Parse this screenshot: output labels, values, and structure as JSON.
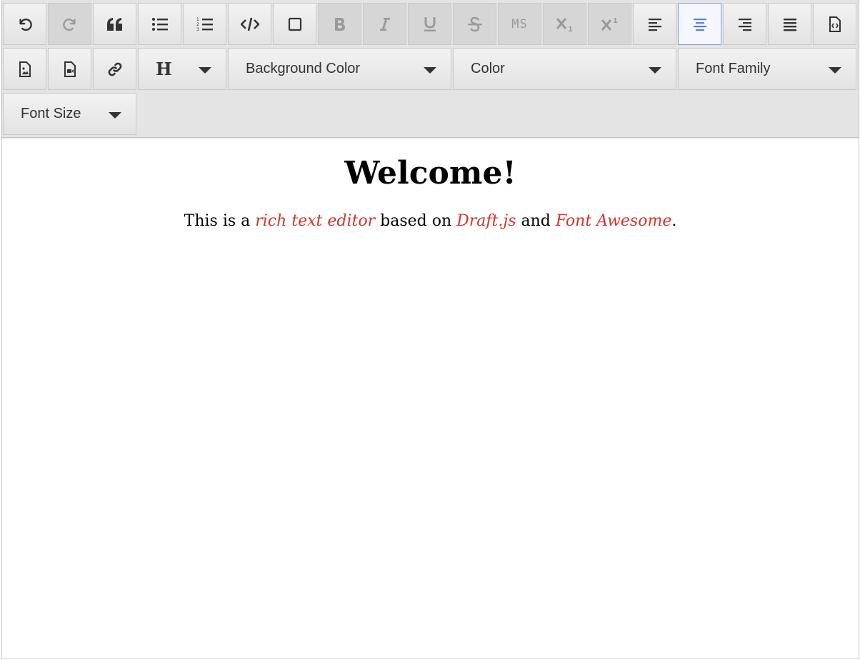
{
  "toolbar": {
    "row1": [
      {
        "name": "undo-button",
        "icon": "undo-icon",
        "state": "normal"
      },
      {
        "name": "redo-button",
        "icon": "redo-icon",
        "state": "disabled"
      },
      {
        "name": "blockquote-button",
        "icon": "quote-icon",
        "state": "normal"
      },
      {
        "name": "unordered-list-button",
        "icon": "list-ul-icon",
        "state": "normal"
      },
      {
        "name": "ordered-list-button",
        "icon": "list-ol-icon",
        "state": "normal"
      },
      {
        "name": "code-block-button",
        "icon": "code-icon",
        "state": "normal"
      },
      {
        "name": "square-button",
        "icon": "square-icon",
        "state": "normal"
      },
      {
        "name": "bold-button",
        "icon": "bold-icon",
        "state": "disabled"
      },
      {
        "name": "italic-button",
        "icon": "italic-icon",
        "state": "disabled"
      },
      {
        "name": "underline-button",
        "icon": "underline-icon",
        "state": "disabled"
      },
      {
        "name": "strikethrough-button",
        "icon": "strikethrough-icon",
        "state": "disabled"
      },
      {
        "name": "monospace-button",
        "icon": "monospace-icon",
        "state": "disabled"
      },
      {
        "name": "subscript-button",
        "icon": "subscript-icon",
        "state": "disabled"
      },
      {
        "name": "superscript-button",
        "icon": "superscript-icon",
        "state": "disabled"
      },
      {
        "name": "align-left-button",
        "icon": "align-left-icon",
        "state": "normal"
      },
      {
        "name": "align-center-button",
        "icon": "align-center-icon",
        "state": "active"
      },
      {
        "name": "align-right-button",
        "icon": "align-right-icon",
        "state": "normal"
      },
      {
        "name": "align-justify-button",
        "icon": "align-justify-icon",
        "state": "normal"
      },
      {
        "name": "insert-code-file-button",
        "icon": "file-code-icon",
        "state": "normal"
      }
    ],
    "row2_icons": [
      {
        "name": "insert-image-button",
        "icon": "file-image-icon"
      },
      {
        "name": "insert-video-button",
        "icon": "file-video-icon"
      },
      {
        "name": "insert-link-button",
        "icon": "link-icon"
      }
    ],
    "monospace_label": "MS",
    "heading_label": "H",
    "background_color_label": "Background Color",
    "color_label": "Color",
    "font_family_label": "Font Family",
    "font_size_label": "Font Size"
  },
  "content": {
    "title": "Welcome!",
    "p1": "This is a ",
    "p2": "rich text editor",
    "p3": " based on ",
    "p4": "Draft.js",
    "p5": " and ",
    "p6": "Font Awesome",
    "p7": "."
  },
  "colors": {
    "accent": "#5b7fe6",
    "link_red": "#d7332b"
  }
}
